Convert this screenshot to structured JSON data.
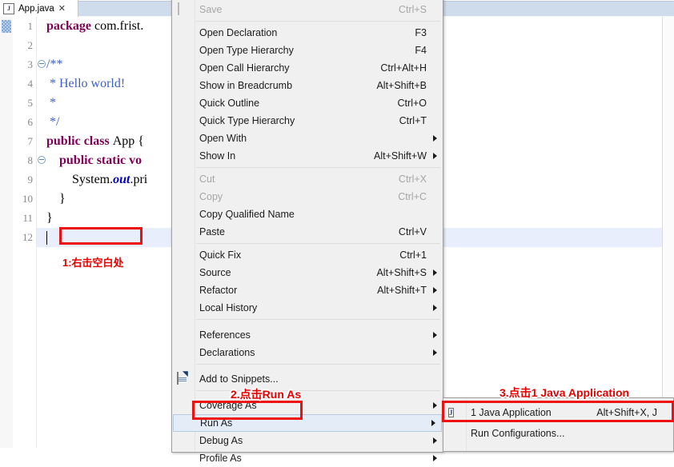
{
  "editor": {
    "tab": {
      "label": "App.java",
      "close_glyph": "✕",
      "file_icon": "java-file-icon",
      "icon_letter": "J"
    },
    "line_numbers": [
      "1",
      "2",
      "3",
      "4",
      "5",
      "6",
      "7",
      "8",
      "9",
      "10",
      "11",
      "12"
    ],
    "current_line": 12,
    "code_lines": [
      {
        "n": 1,
        "segments": [
          {
            "t": "package ",
            "c": "kw"
          },
          {
            "t": "com.frist.",
            "c": ""
          }
        ]
      },
      {
        "n": 2,
        "segments": [
          {
            "t": "",
            "c": ""
          }
        ]
      },
      {
        "n": 3,
        "segments": [
          {
            "t": "/**",
            "c": "cmt"
          }
        ],
        "fold": true
      },
      {
        "n": 4,
        "segments": [
          {
            "t": " * Hello world!",
            "c": "cmt"
          }
        ]
      },
      {
        "n": 5,
        "segments": [
          {
            "t": " *",
            "c": "cmt"
          }
        ]
      },
      {
        "n": 6,
        "segments": [
          {
            "t": " */",
            "c": "cmt"
          }
        ]
      },
      {
        "n": 7,
        "segments": [
          {
            "t": "public class ",
            "c": "kw"
          },
          {
            "t": "App {",
            "c": ""
          }
        ]
      },
      {
        "n": 8,
        "segments": [
          {
            "t": "    public static vo",
            "c": "kw"
          }
        ],
        "fold": true
      },
      {
        "n": 9,
        "segments": [
          {
            "t": "        System.",
            "c": ""
          },
          {
            "t": "out",
            "c": "fld"
          },
          {
            "t": ".pri",
            "c": ""
          }
        ]
      },
      {
        "n": 10,
        "segments": [
          {
            "t": "    }",
            "c": ""
          }
        ]
      },
      {
        "n": 11,
        "segments": [
          {
            "t": "}",
            "c": ""
          }
        ]
      },
      {
        "n": 12,
        "segments": [
          {
            "t": "",
            "c": ""
          }
        ]
      }
    ]
  },
  "context_menu": {
    "items": [
      {
        "label": "Save",
        "accel": "Ctrl+S",
        "disabled": true,
        "icon": "save-icon"
      },
      {
        "separator": true
      },
      {
        "label": "Open Declaration",
        "accel": "F3"
      },
      {
        "label": "Open Type Hierarchy",
        "accel": "F4"
      },
      {
        "label": "Open Call Hierarchy",
        "accel": "Ctrl+Alt+H"
      },
      {
        "label": "Show in Breadcrumb",
        "accel": "Alt+Shift+B"
      },
      {
        "label": "Quick Outline",
        "accel": "Ctrl+O"
      },
      {
        "label": "Quick Type Hierarchy",
        "accel": "Ctrl+T"
      },
      {
        "label": "Open With",
        "accel": "",
        "arrow": true
      },
      {
        "label": "Show In",
        "accel": "Alt+Shift+W",
        "arrow": true
      },
      {
        "separator": true
      },
      {
        "label": "Cut",
        "accel": "Ctrl+X",
        "disabled": true
      },
      {
        "label": "Copy",
        "accel": "Ctrl+C",
        "disabled": true
      },
      {
        "label": "Copy Qualified Name",
        "accel": ""
      },
      {
        "label": "Paste",
        "accel": "Ctrl+V"
      },
      {
        "separator": true
      },
      {
        "label": "Quick Fix",
        "accel": "Ctrl+1"
      },
      {
        "label": "Source",
        "accel": "Alt+Shift+S",
        "arrow": true
      },
      {
        "label": "Refactor",
        "accel": "Alt+Shift+T",
        "arrow": true
      },
      {
        "label": "Local History",
        "accel": "",
        "arrow": true
      },
      {
        "separator": true
      },
      {
        "label": "References",
        "accel": "",
        "arrow": true
      },
      {
        "label": "Declarations",
        "accel": "",
        "arrow": true
      },
      {
        "separator": true
      },
      {
        "label": "Add to Snippets...",
        "accel": "",
        "icon": "snippet-icon"
      },
      {
        "separator": true
      },
      {
        "label": "Coverage As",
        "accel": "",
        "arrow": true
      },
      {
        "label": "Run As",
        "accel": "",
        "arrow": true,
        "selected": true
      },
      {
        "label": "Debug As",
        "accel": "",
        "arrow": true
      },
      {
        "label": "Profile As",
        "accel": "",
        "arrow": true
      }
    ]
  },
  "submenu": {
    "items": [
      {
        "label": "1 Java Application",
        "accel": "Alt+Shift+X, J",
        "icon": "java-app-icon",
        "highlighted": true
      },
      {
        "label": "Run Configurations...",
        "accel": ""
      }
    ]
  },
  "annotations": [
    {
      "id": "step1",
      "text": "1:右击空白处"
    },
    {
      "id": "step2",
      "text": "2.点击Run As"
    },
    {
      "id": "step3",
      "text": "3.点击1 Java Application"
    }
  ],
  "colors": {
    "annotation_red": "#e60000",
    "box_red": "#ee1111",
    "keyword": "#7f0055",
    "comment": "#3f5fbf",
    "field": "#0000c0",
    "current_line": "#e8eefb",
    "menu_bg": "#f0f0f0",
    "selection": "#e4ecf7"
  }
}
